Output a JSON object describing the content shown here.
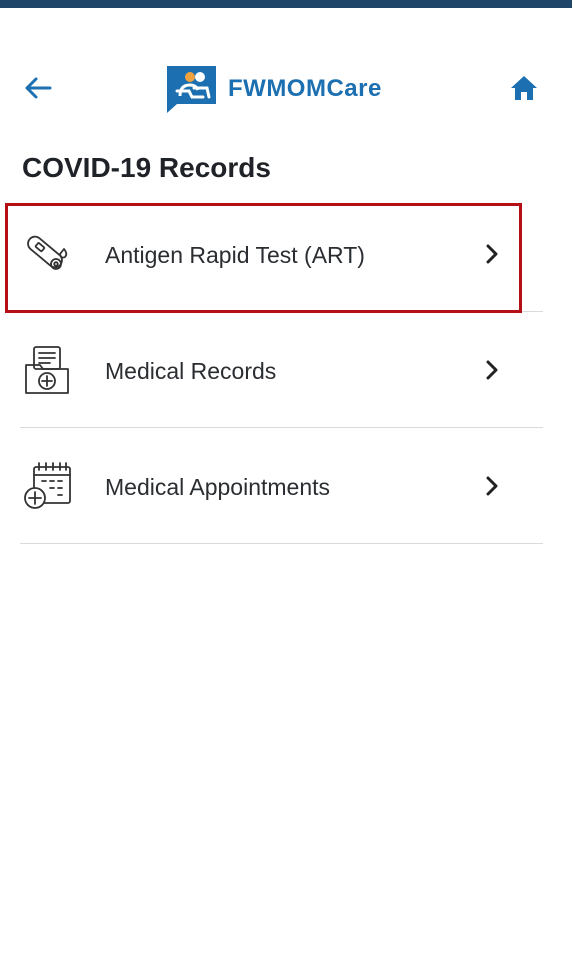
{
  "header": {
    "app_name": "FWMOMCare",
    "brand_color": "#1c6fb0",
    "back_icon": "arrow-left-icon",
    "home_icon": "home-icon"
  },
  "page": {
    "title": "COVID-19 Records"
  },
  "items": [
    {
      "label": "Antigen Rapid Test (ART)",
      "icon": "test-kit-icon"
    },
    {
      "label": "Medical Records",
      "icon": "medical-folder-icon"
    },
    {
      "label": "Medical Appointments",
      "icon": "calendar-medical-icon"
    }
  ],
  "highlight_color": "#b30f14",
  "top_bar_color": "#1f4568"
}
